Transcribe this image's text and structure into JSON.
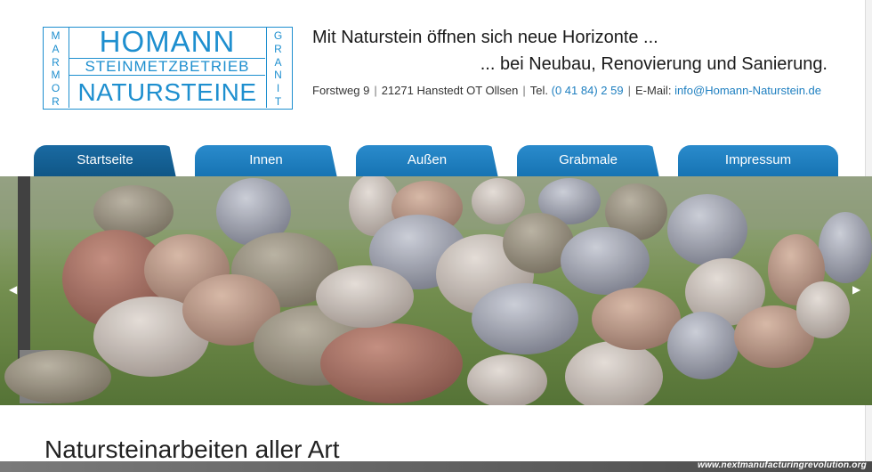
{
  "logo": {
    "left_vertical": "MARMOR",
    "right_vertical": "GRANIT",
    "line1": "HOMANN",
    "line2": "STEINMETZBETRIEB",
    "line3": "NATURSTEINE"
  },
  "header": {
    "slogan_line1": "Mit Naturstein öffnen sich neue Horizonte ...",
    "slogan_line2": "... bei Neubau, Renovierung und Sanierung.",
    "address": "Forstweg 9",
    "city": "21271 Hanstedt OT Ollsen",
    "tel_label": "Tel.",
    "tel_value": "(0 41 84) 2 59",
    "email_label": "E-Mail:",
    "email_value": "info@Homann-Naturstein.de",
    "separator": "|"
  },
  "nav": {
    "items": [
      {
        "label": "Startseite",
        "active": true
      },
      {
        "label": "Innen",
        "active": false
      },
      {
        "label": "Außen",
        "active": false
      },
      {
        "label": "Grabmale",
        "active": false
      },
      {
        "label": "Impressum",
        "active": false
      }
    ]
  },
  "slider": {
    "prev_symbol": "◀",
    "next_symbol": "▶"
  },
  "main": {
    "heading": "Natursteinarbeiten aller Art"
  },
  "watermark": "www.nextmanufacturingrevolution.org",
  "colors": {
    "brand_blue": "#1e8fcf",
    "nav_blue": "#1673b2",
    "nav_active": "#0f5686"
  }
}
